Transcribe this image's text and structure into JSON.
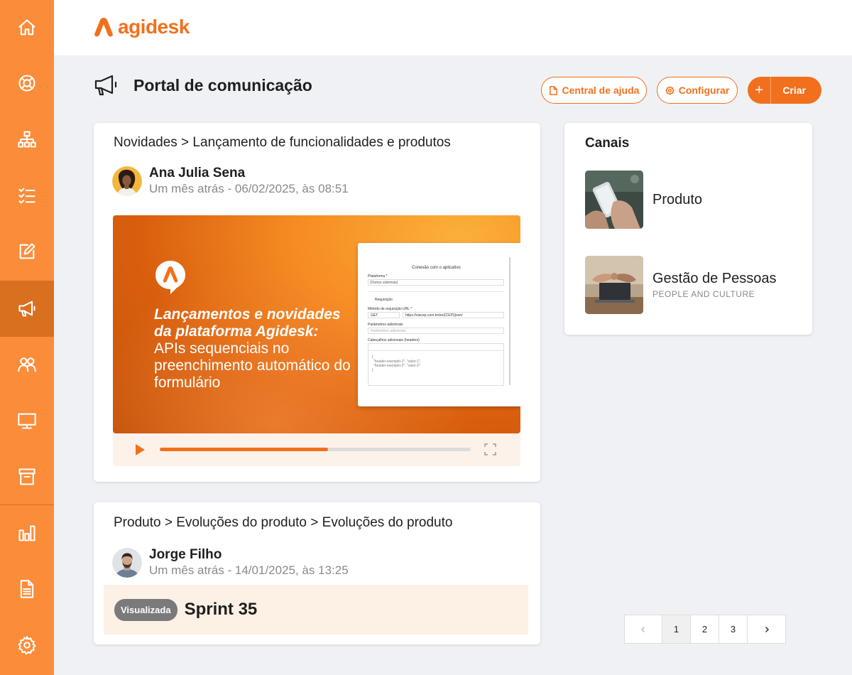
{
  "brand": {
    "name": "agidesk",
    "color": "#f2701d"
  },
  "sidebar": {
    "items": [
      {
        "icon": "home-icon"
      },
      {
        "icon": "lifebuoy-icon"
      },
      {
        "icon": "org-chart-icon"
      },
      {
        "icon": "checklist-icon"
      },
      {
        "icon": "edit-icon"
      },
      {
        "icon": "megaphone-icon",
        "active": true
      },
      {
        "icon": "users-icon"
      },
      {
        "icon": "monitor-icon"
      },
      {
        "icon": "box-icon"
      },
      {
        "icon": "bar-chart-icon"
      },
      {
        "icon": "document-icon"
      },
      {
        "icon": "gear-icon"
      }
    ]
  },
  "header": {
    "title": "Portal de comunicação",
    "help_label": "Central de ajuda",
    "configure_label": "Configurar",
    "create_plus": "+",
    "create_label": "Criar"
  },
  "posts": [
    {
      "breadcrumb": "Novidades > Lançamento de funcionalidades e produtos",
      "author": "Ana Julia Sena",
      "date": "Um mês atrás - 06/02/2025, às 08:51",
      "video": {
        "headline": "Lançamentos e novidades da plataforma Agidesk:",
        "subline": "APIs sequenciais no preenchimento automático do formulário",
        "progress": 0.54,
        "screenshot": {
          "title": "Conexão com o aplicativo",
          "platform_label": "Plataforma *",
          "platform_value": "(Outros sistemas)",
          "request_label": "Requisição",
          "method_label": "Método de requisição",
          "method_value": "GET",
          "url_label": "URL *",
          "url_value": "https://viacep.com.br/ws/{CEP}/json/",
          "params_label": "Parâmetros adicionais",
          "params_placeholder": "Parâmetros adicionais",
          "headers_label": "Cabeçalhos adicionais (headers)",
          "code_line1": "{",
          "code_line2": "\"header-exemplo-1\": \"valor-1\",",
          "code_line3": "\"header-exemplo-2\": \"valor-2\"",
          "code_line4": "}"
        }
      }
    },
    {
      "breadcrumb": "Produto > Evoluções do produto > Evoluções do produto",
      "author": "Jorge Filho",
      "date": "Um mês atrás - 14/01/2025, às 13:25",
      "badge": "Visualizada",
      "title": "Sprint 35"
    }
  ],
  "channels": {
    "title": "Canais",
    "items": [
      {
        "name": "Produto",
        "subtitle": ""
      },
      {
        "name": "Gestão de Pessoas",
        "subtitle": "PEOPLE AND CULTURE"
      }
    ]
  },
  "pagination": {
    "pages": [
      "1",
      "2",
      "3"
    ],
    "current": "1"
  }
}
